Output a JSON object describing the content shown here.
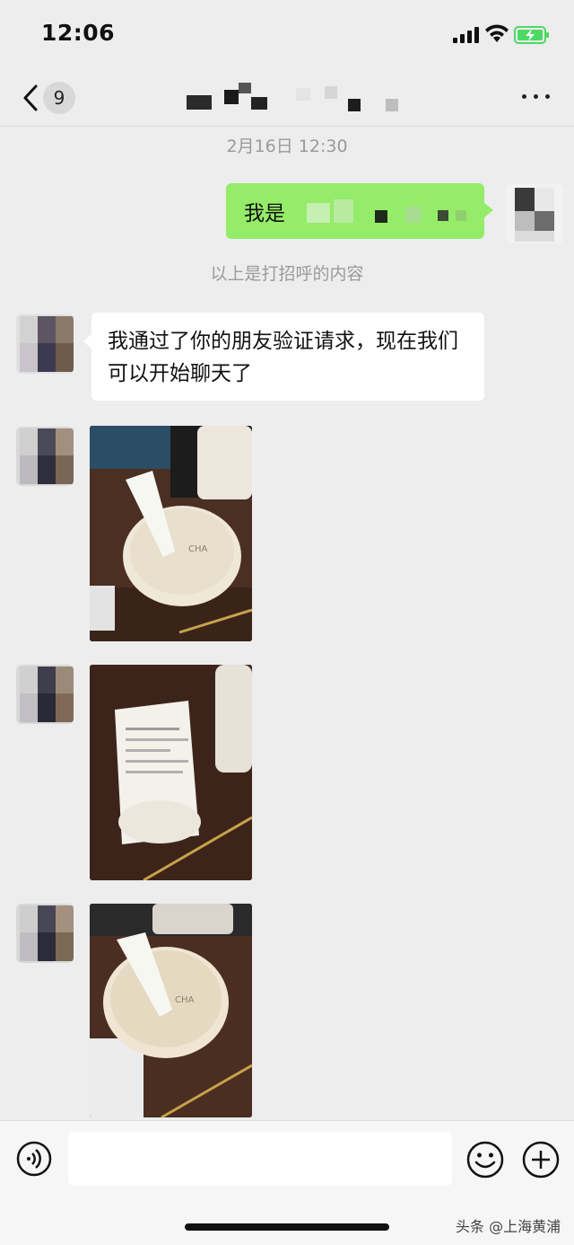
{
  "status_bar": {
    "time": "12:06",
    "icons": [
      "cellular-signal-icon",
      "wifi-icon",
      "battery-charging-icon"
    ],
    "battery_color": "#4cd964"
  },
  "nav": {
    "unread_count": "9",
    "icons": [
      "chevron-left-icon",
      "more-icon"
    ]
  },
  "messages": {
    "timestamp": "2月16日 12:30",
    "outgoing_text": "我是",
    "system_note": "以上是打招呼的内容",
    "incoming_text": "我通过了你的朋友验证请求，现在我们可以开始聊天了",
    "photo_count": 3
  },
  "input_bar": {
    "icons": [
      "voice-icon",
      "emoji-icon",
      "plus-icon"
    ]
  },
  "watermark": "头条 @上海黄浦",
  "colors": {
    "background": "#ededed",
    "outgoing_bubble": "#95ec69",
    "incoming_bubble": "#ffffff",
    "meta_text": "#9a9a9a"
  }
}
